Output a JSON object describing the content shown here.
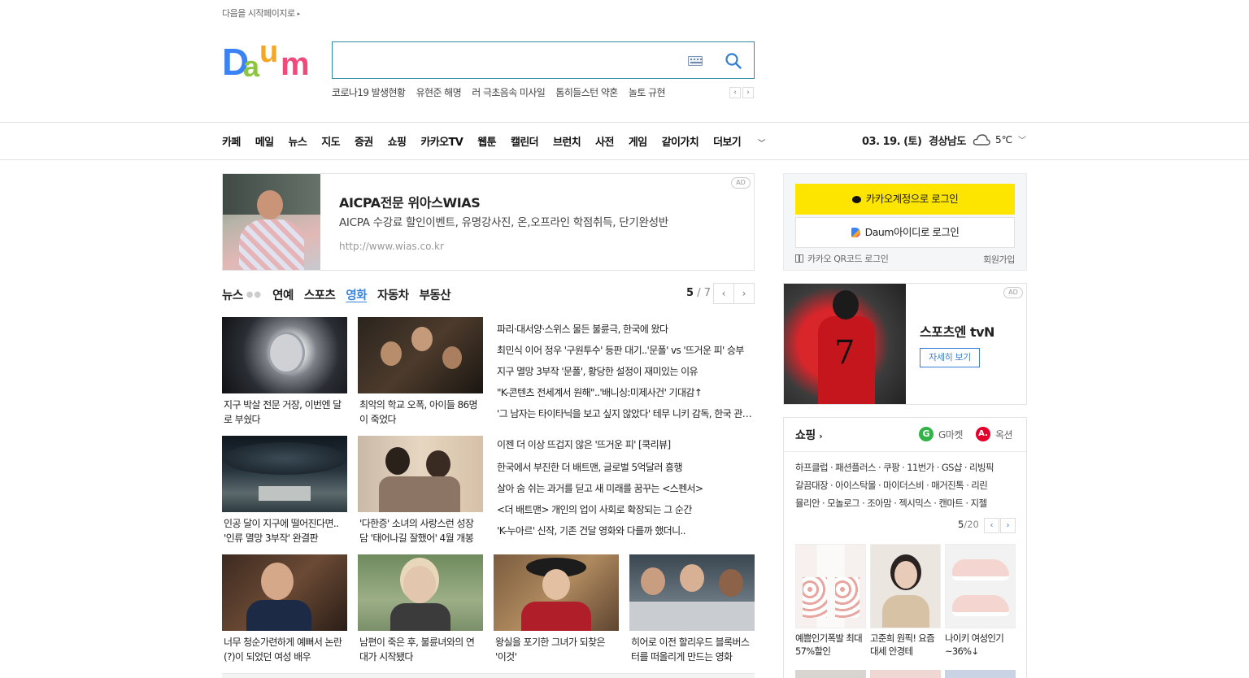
{
  "header": {
    "start_page": "다음을 시작페이지로",
    "logo_letters": [
      "D",
      "a",
      "u",
      "m"
    ]
  },
  "search": {
    "value": "",
    "placeholder": ""
  },
  "suggest": [
    "코로나19 발생현황",
    "유현준 해명",
    "러 극초음속 미사일",
    "톰히들스턴 약혼",
    "놀토 규현"
  ],
  "nav": {
    "items": [
      "카페",
      "메일",
      "뉴스",
      "지도",
      "증권",
      "쇼핑",
      "카카오TV",
      "웹툰",
      "캘린더",
      "브런치",
      "사전",
      "게임",
      "같이가치"
    ],
    "more": "더보기",
    "date": "03. 19. (토)",
    "region": "경상남도",
    "temp": "5℃"
  },
  "ad_banner": {
    "title": "AICPA전문 위아스WIAS",
    "desc": "AICPA 수강료 할인이벤트, 유명강사진, 온,오프라인 학점취득, 단기완성반",
    "url": "http://www.wias.co.kr",
    "tag": "AD"
  },
  "tabs": {
    "items": [
      "뉴스",
      "연예",
      "스포츠",
      "영화",
      "자동차",
      "부동산"
    ],
    "active": "영화",
    "page_current": "5",
    "page_total": "/ 7"
  },
  "news_cards": [
    {
      "caption": "지구 박살 전문 거장, 이번엔 달로 부쉈다"
    },
    {
      "caption": "최악의 학교 오폭, 아이들 86명이 죽었다"
    },
    {
      "caption": "인공 달이 지구에 떨어진다면.. '인류 멸망 3부작' 완결판"
    },
    {
      "caption": "'다한증' 소녀의 사랑스런 성장담 '태어나길 잘했어' 4월 개봉"
    },
    {
      "caption": "너무 청순가련하게 예뻐서 논란(?)이 되었던 여성 배우"
    },
    {
      "caption": "남편이 죽은 후, 불륜녀와의 연대가 시작됐다"
    },
    {
      "caption": "왕실을 포기한 그녀가 되찾은 '이것'"
    },
    {
      "caption": "히어로 이전 할리우드 블록버스터를 떠올리게 만드는 영화"
    }
  ],
  "headlines_top": [
    "파리·대서양·스위스 물든 불륜극, 한국에 왔다",
    "최민식 이어 정우 '구원투수' 등판 대기..'문폴' vs '뜨거운 피' 승부",
    "지구 멸망 3부작 '문폴', 황당한 설정이 재미있는 이유",
    "\"K-콘텐츠 전세계서 원해\"..'배니싱:미제사건' 기대감↑",
    "'그 남자는 타이타닉을 보고 싶지 않았다' 테무 니키 감독, 한국 관객 만난다"
  ],
  "headlines_bottom": [
    "이젠 더 이상 뜨겁지 않은 '뜨거운 피' [쿡리뷰]",
    "한국에서 부진한 더 배트맨, 글로벌 5억달러 흥행",
    "살아 숨 쉬는 과거를 딛고 새 미래를 꿈꾸는 <스펜서>",
    "<더 배트맨> 개인의 업이 사회로 확장되는 그 순간",
    "'K-누아르' 신작, 기존 건달 영화와 다를까 했더니.."
  ],
  "login": {
    "kakao": "카카오계정으로 로그인",
    "daum": "Daum아이디로 로그인",
    "qr": "카카오 QR코드 로그인",
    "join": "회원가입"
  },
  "side_ad": {
    "title": "스포츠엔 tvN",
    "more": "자세히 보기",
    "tag": "AD",
    "jersey_number": "7"
  },
  "shopping": {
    "title": "쇼핑",
    "gmarket": "G마켓",
    "auction": "옥션",
    "links": [
      "하프클럽 · 패션플러스 · 쿠팡 · 11번가 · GS샵 · 리빙픽",
      "갈끔대장 · 아이스탁몰 · 마이더스비 · 매거진톡 · 리린",
      "뮬리안 · 모놀로그 · 조아맘 · 젝시믹스 · 캔마트 · 지젤"
    ],
    "page_current": "5",
    "page_total": "/20",
    "products": [
      {
        "caption": "예쁨인기폭발 최대57%할인"
      },
      {
        "caption": "고준희 원픽! 요즘대세 안경테"
      },
      {
        "caption": "나이키 여성인기 ~36%↓"
      }
    ]
  },
  "colors": {
    "accent": "#3a84d8",
    "search_border": "#2d8ca0",
    "kakao_yellow": "#fee500",
    "gmarket_green": "#33b24a",
    "auction_red": "#e4002b"
  }
}
